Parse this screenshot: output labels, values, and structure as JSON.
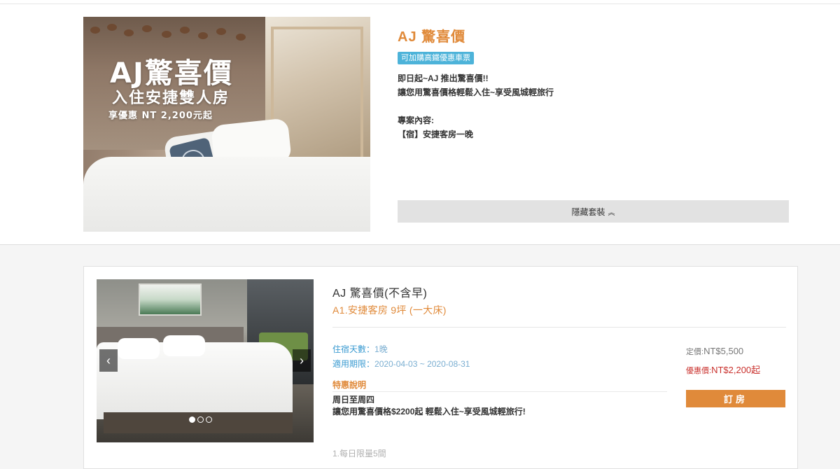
{
  "promo": {
    "image_title": "AJ驚喜價",
    "image_subtitle": "入住安捷雙人房",
    "image_price": "享優惠 NT 2,200元起",
    "title": "AJ 驚喜價",
    "badge": "可加購高鐵優惠車票",
    "desc_line1": "即日起~AJ 推出驚喜價!!",
    "desc_line2": "讓您用驚喜價格輕鬆入住~享受風城輕旅行",
    "content_label": "專案內容:",
    "content_item": "【宿】安捷客房一晚",
    "toggle_label": "隱藏套裝",
    "toggle_icon": "chevron-up-icon"
  },
  "room": {
    "name": "AJ 驚喜價(不含早)",
    "type": "A1.安捷客房 9坪 (一大床)",
    "nights_label": "住宿天數：",
    "nights_value": "1晚",
    "period_label": "適用期限：",
    "period_value": "2020-04-03 ~ 2020-08-31",
    "special_label": "特惠說明",
    "special_line1": "周日至周四",
    "special_line2": "讓您用驚喜價格$2200起 輕鬆入住~享受風城輕旅行!",
    "note": "1.每日限量5間",
    "list_price_label": "定價:",
    "list_price": "NT$5,500",
    "sale_price_label": "優惠價:",
    "sale_price": "NT$2,200起",
    "book_label": "訂房",
    "gallery": {
      "prev": "‹",
      "next": "›",
      "slides": 3,
      "active_slide": 1
    }
  },
  "colors": {
    "accent": "#e08a3a",
    "badge": "#4db3d9",
    "info_key": "#3b9bd1",
    "sale": "#c9302c"
  }
}
